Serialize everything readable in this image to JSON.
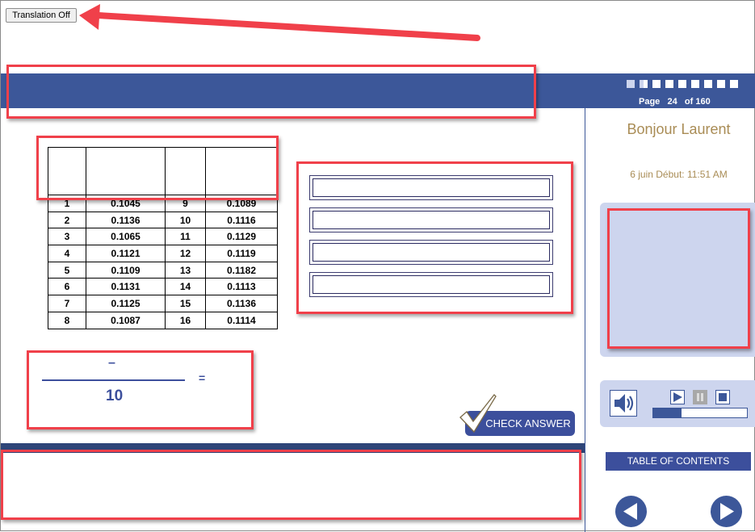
{
  "toolbar": {
    "translation_label": "Translation Off"
  },
  "header": {
    "page_label": "Page",
    "page_current": "24",
    "page_of": "of",
    "page_total": "160",
    "progress_dots": 9,
    "progress_fraction": 0.1
  },
  "sidebar": {
    "greeting": "Bonjour Laurent",
    "session": "6 juin Début: 11:51 AM",
    "toc_label": "TABLE OF CONTENTS",
    "audio_progress_percent": 30
  },
  "table": {
    "rows": [
      [
        "1",
        "0.1045",
        "9",
        "0.1089"
      ],
      [
        "2",
        "0.1136",
        "10",
        "0.1116"
      ],
      [
        "3",
        "0.1065",
        "11",
        "0.1129"
      ],
      [
        "4",
        "0.1121",
        "12",
        "0.1119"
      ],
      [
        "5",
        "0.1109",
        "13",
        "0.1182"
      ],
      [
        "6",
        "0.1131",
        "14",
        "0.1113"
      ],
      [
        "7",
        "0.1125",
        "15",
        "0.1136"
      ],
      [
        "8",
        "0.1087",
        "16",
        "0.1114"
      ]
    ]
  },
  "formula": {
    "numerator": "–",
    "denominator": "10",
    "equals": "="
  },
  "main": {
    "check_label": "CHECK ANSWER"
  },
  "colors": {
    "brand": "#3c5799",
    "annotation": "#f0404a",
    "greeting": "#a98c55"
  }
}
